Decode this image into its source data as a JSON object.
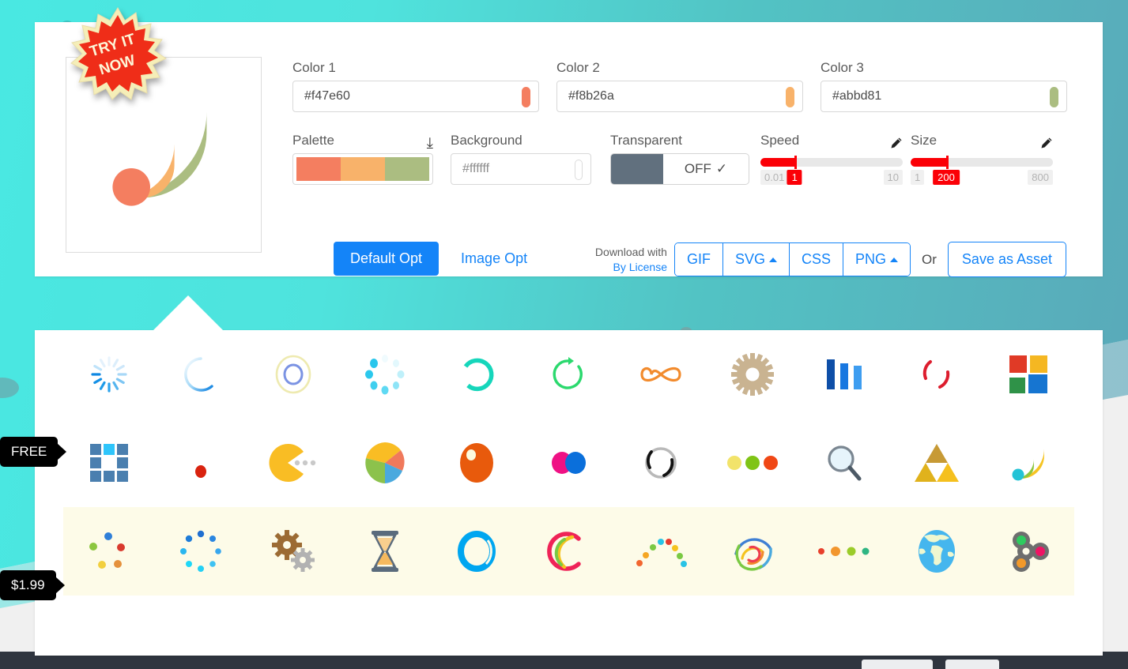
{
  "colors": {
    "color1": {
      "label": "Color 1",
      "value": "#f47e60"
    },
    "color2": {
      "label": "Color 2",
      "value": "#f8b26a"
    },
    "color3": {
      "label": "Color 3",
      "value": "#abbd81"
    }
  },
  "palette": {
    "label": "Palette",
    "chevron": "chevron-double-down",
    "swatches": [
      "#f47e60",
      "#f8b26a",
      "#abbd81"
    ]
  },
  "background": {
    "label": "Background",
    "value": "#ffffff"
  },
  "transparent": {
    "label": "Transparent",
    "state": "OFF"
  },
  "speed": {
    "label": "Speed",
    "min": "0.01",
    "max": "10",
    "value": "1",
    "fill_percent": 24
  },
  "size": {
    "label": "Size",
    "min": "1",
    "max": "800",
    "value": "200",
    "fill_percent": 25
  },
  "actions": {
    "default_opt": "Default Opt",
    "image_opt": "Image Opt",
    "download_with": "Download with",
    "by_license": "By License",
    "formats": [
      "GIF",
      "SVG",
      "CSS",
      "PNG"
    ],
    "or": "Or",
    "save_as_asset": "Save as Asset"
  },
  "preview": {
    "badge_line1": "TRY IT",
    "badge_line2": "NOW",
    "icon": "rss-loader-icon"
  },
  "tags": {
    "free": "FREE",
    "price": "$1.99"
  },
  "gallery": {
    "rows": [
      {
        "highlight": false,
        "icons": [
          "spinner-rays-blue",
          "crescent-arc-blue",
          "ring-double-yellow-blue",
          "spinner-dots-cyan",
          "arc-spinner-teal",
          "refresh-arrow-green",
          "infinity-orange",
          "gear-tan",
          "bars-blue",
          "split-ring-red",
          "squares-four-color"
        ]
      },
      {
        "highlight": false,
        "icons": [
          "grid-nine-blue",
          "dot-red",
          "pacman-yellow",
          "pie-chart-multicolor",
          "ball-orange",
          "two-dots-pink-blue",
          "split-ring-black",
          "three-dots-yellow-green-red",
          "magnifier-gray",
          "triforce-gold",
          "rss-wave-yellow-green"
        ]
      },
      {
        "highlight": true,
        "icons": [
          "dots-scatter-multicolor",
          "dotted-ring-blue",
          "gears-two-brown-gray",
          "hourglass-orange",
          "ring-thick-blue",
          "arc-rainbow-c",
          "dots-arch-multicolor",
          "rings-rainbow-circle",
          "dots-row-multicolor",
          "globe-earth",
          "fidget-spinner-multicolor"
        ]
      }
    ]
  }
}
